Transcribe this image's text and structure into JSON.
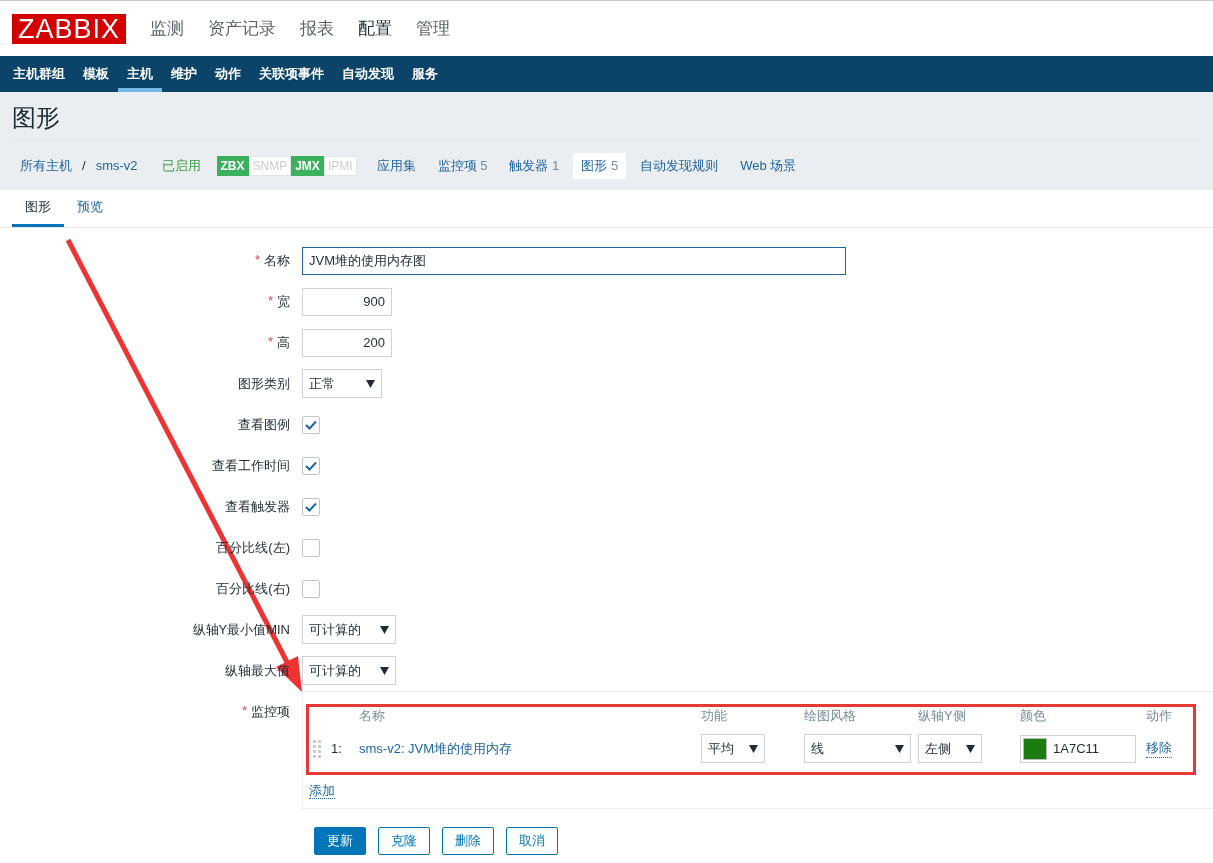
{
  "logo": "ZABBIX",
  "main_menu": [
    {
      "label": "监测",
      "selected": false
    },
    {
      "label": "资产记录",
      "selected": false
    },
    {
      "label": "报表",
      "selected": false
    },
    {
      "label": "配置",
      "selected": true
    },
    {
      "label": "管理",
      "selected": false
    }
  ],
  "sub_menu": [
    {
      "label": "主机群组",
      "selected": false
    },
    {
      "label": "模板",
      "selected": false
    },
    {
      "label": "主机",
      "selected": true
    },
    {
      "label": "维护",
      "selected": false
    },
    {
      "label": "动作",
      "selected": false
    },
    {
      "label": "关联项事件",
      "selected": false
    },
    {
      "label": "自动发现",
      "selected": false
    },
    {
      "label": "服务",
      "selected": false
    }
  ],
  "page_title": "图形",
  "breadcrumb": {
    "root": "所有主机",
    "separator": "/",
    "host": "sms-v2"
  },
  "host_status": "已启用",
  "availability": [
    {
      "label": "ZBX",
      "on": true
    },
    {
      "label": "SNMP",
      "on": false
    },
    {
      "label": "JMX",
      "on": true
    },
    {
      "label": "IPMI",
      "on": false
    }
  ],
  "host_tabs": [
    {
      "label": "应用集",
      "selected": false
    },
    {
      "label": "监控项",
      "count": "5",
      "selected": false
    },
    {
      "label": "触发器",
      "count": "1",
      "selected": false
    },
    {
      "label": "图形",
      "count": "5",
      "selected": true
    },
    {
      "label": "自动发现规则",
      "selected": false
    },
    {
      "label": "Web 场景",
      "selected": false
    }
  ],
  "form_tabs": [
    {
      "label": "图形",
      "selected": true
    },
    {
      "label": "预览",
      "selected": false
    }
  ],
  "fields": [
    {
      "kind": "text",
      "label": "名称",
      "required_mark": "*",
      "value": "JVM堆的使用内存图"
    },
    {
      "kind": "number",
      "label": "宽",
      "required_mark": "*",
      "value": "900"
    },
    {
      "kind": "number",
      "label": "高",
      "required_mark": "*",
      "value": "200"
    },
    {
      "kind": "select",
      "label": "图形类别",
      "value": "正常"
    },
    {
      "kind": "checkbox",
      "label": "查看图例",
      "checked": true
    },
    {
      "kind": "checkbox",
      "label": "查看工作时间",
      "checked": true
    },
    {
      "kind": "checkbox",
      "label": "查看触发器",
      "checked": true
    },
    {
      "kind": "checkbox",
      "label": "百分比线(左)",
      "checked": false
    },
    {
      "kind": "checkbox",
      "label": "百分比线(右)",
      "checked": false
    },
    {
      "kind": "select",
      "label": "纵轴Y最小值MIN",
      "value": "可计算的"
    },
    {
      "kind": "select",
      "label": "纵轴最大值",
      "value": "可计算的"
    }
  ],
  "items": {
    "label": "监控项",
    "required_mark": "*",
    "columns": [
      "名称",
      "功能",
      "绘图风格",
      "纵轴Y侧",
      "颜色",
      "动作"
    ],
    "rows": [
      {
        "number": "1:",
        "name": "sms-v2: JVM堆的使用内存",
        "function": "平均",
        "style": "线",
        "y_axis": "左侧",
        "color": "#1a7c11",
        "color_code": "1A7C11",
        "action": "移除"
      }
    ],
    "add": "添加"
  },
  "buttons": [
    {
      "label": "更新",
      "kind": "primary"
    },
    {
      "label": "克隆",
      "kind": "secondary"
    },
    {
      "label": "删除",
      "kind": "secondary"
    },
    {
      "label": "取消",
      "kind": "secondary"
    }
  ],
  "annotations": {
    "arrow": true,
    "box": true
  }
}
